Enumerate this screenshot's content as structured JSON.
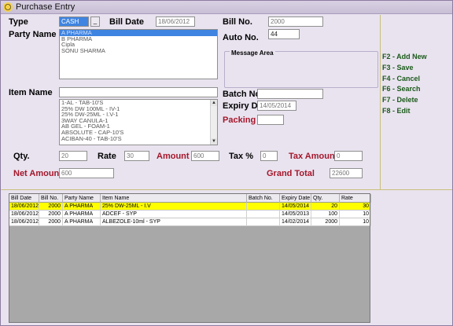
{
  "window": {
    "title": "Purchase Entry",
    "icon": "app-icon"
  },
  "labels": {
    "type": "Type",
    "bill_date": "Bill Date",
    "bill_no": "Bill No.",
    "party_name": "Party Name",
    "auto_no": "Auto No.",
    "message_area": "Message Area",
    "item_name": "Item Name",
    "batch_no": "Batch No.",
    "expiry_dt": "Expiry Dt.",
    "packing": "Packing",
    "qty": "Qty.",
    "rate": "Rate",
    "amount": "Amount",
    "tax_pct": "Tax %",
    "tax_amount": "Tax Amount",
    "net_amount": "Net Amount",
    "grand_total": "Grand Total"
  },
  "fields": {
    "type": "CASH",
    "bill_date": "18/06/2012",
    "bill_no": "2000",
    "auto_no": "44",
    "item_name": "",
    "batch_no": "",
    "expiry_dt": "14/05/2014",
    "packing": "",
    "qty": "20",
    "rate": "30",
    "amount": "600",
    "tax_pct": "0",
    "tax_amount": "0",
    "net_amount": "600",
    "grand_total": "22600"
  },
  "party_list": [
    "A PHARMA",
    "B PHARMA",
    "Cipla",
    "SONU SHARMA"
  ],
  "item_list": [
    "1-AL - TAB-10'S",
    "25% DW 100ML - IV-1",
    "25% DW-25ML - I.V-1",
    "3WAY CANULA-1",
    "AB GEL - FOAM-1",
    "ABSOLUTE - CAP-10'S",
    "ACIBAN-40 - TAB-10'S"
  ],
  "function_keys": [
    "F2 - Add New",
    "F3 - Save",
    "F4 - Cancel",
    "F6 - Search",
    "F7 - Delete",
    "F8 - Edit"
  ],
  "grid": {
    "headers": [
      "Bill Date",
      "Bill No.",
      "Party Name",
      "Item Name",
      "Batch No.",
      "Expiry Date",
      "Qty.",
      "Rate"
    ],
    "rows": [
      [
        "18/06/2012",
        "2000",
        "A PHARMA",
        "25% DW-25ML - I.V",
        "",
        "14/05/2014",
        "20",
        "30"
      ],
      [
        "18/06/2012",
        "2000",
        "A PHARMA",
        "ADCEF - SYP",
        "",
        "14/05/2013",
        "100",
        "10"
      ],
      [
        "18/06/2012",
        "2000",
        "A PHARMA",
        "ALBEZOLE-10ml - SYP",
        "",
        "14/02/2014",
        "2000",
        "10"
      ]
    ]
  },
  "colors": {
    "highlight_row": "#ffff00",
    "selection": "#3f84e0",
    "label_red": "#a4172b",
    "fkey_green": "#1a5a1a"
  }
}
